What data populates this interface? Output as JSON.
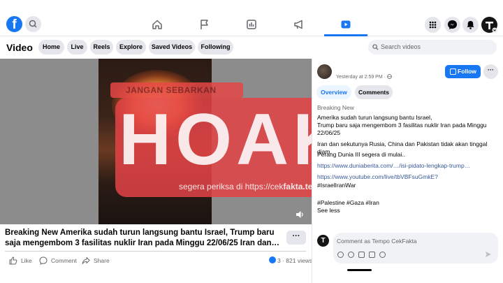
{
  "nav": {
    "logo": "f",
    "icons": [
      "search-icon",
      "home-icon",
      "flag-icon",
      "marketplace-icon",
      "megaphone-icon",
      "video-icon",
      "menu-grid-icon",
      "messenger-icon",
      "bell-icon",
      "profile-icon"
    ]
  },
  "subheader": {
    "title": "Video",
    "pills": [
      "Home",
      "Live",
      "Reels",
      "Explore",
      "Saved Videos",
      "Following"
    ],
    "search_placeholder": "Search videos"
  },
  "video": {
    "watermark_top": "JANGAN SEBARKAN",
    "stamp": "HOAKS",
    "watermark_bottom_prefix": "segera periksa di https://cek",
    "watermark_bottom_domain": "fakta.tempo.co"
  },
  "post": {
    "title": "Breaking New Amerika sudah turun langsung bantu Israel, Trump baru saja mengembom 3 fasilitas nuklir Iran pada Minggu 22/06/25 Iran dan…",
    "more": "···",
    "actions": {
      "like": "Like",
      "comment": "Comment",
      "share": "Share"
    },
    "reactions": "3",
    "views": "821 views"
  },
  "panel": {
    "time": "Yesterday at 2:59 PM · ",
    "follow": "Follow",
    "more": "···",
    "tabs": {
      "overview": "Overview",
      "comments": "Comments"
    },
    "description": {
      "line1": "Breaking New",
      "line2": "Amerika sudah turun langsung bantu Israel,",
      "line3": "Trump baru saja mengembom 3 fasilitas nuklir Iran pada Minggu",
      "line4": "22/06/25",
      "line5": "Iran dan sekutunya Rusia, China dan Pakistan tidak akan tinggal diam.",
      "line6": "Perang Dunia III segera di mulai..",
      "link1": "https://www.duniaberita.com/…/isi-pidato-lengkap-trump…",
      "link2": "https://www.youtube.com/live/tbVBFsuGmkE?",
      "line7": "#IsraelIranWar",
      "hashtags": "#Palestine #Gaza #Iran",
      "see_less": "See less"
    },
    "comment_placeholder": "Comment as Tempo CekFakta",
    "comment_avatar": "T"
  }
}
